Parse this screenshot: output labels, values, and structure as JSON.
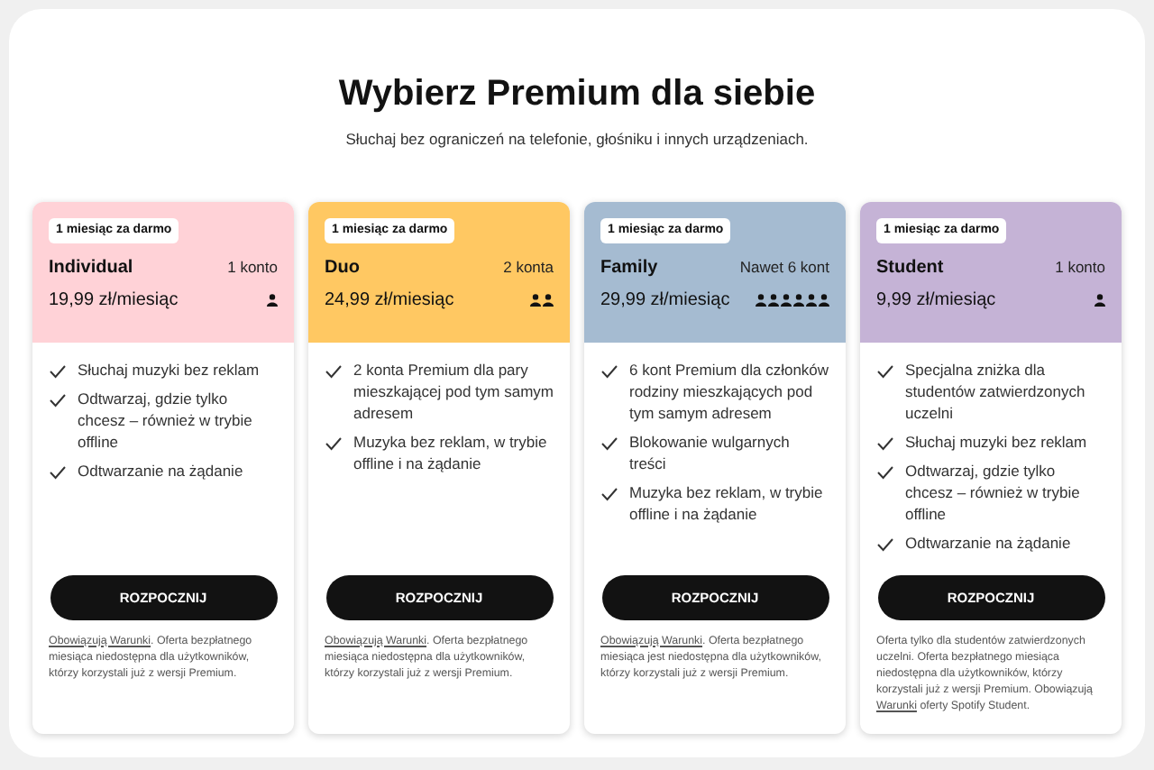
{
  "title": "Wybierz Premium dla siebie",
  "subtitle": "Słuchaj bez ograniczeń na telefonie, głośniku i innych urządzeniach.",
  "plans": [
    {
      "badge": "1 miesiąc za darmo",
      "name": "Individual",
      "accounts": "1 konto",
      "kind": "single",
      "price": "19,99 zł/miesiąc",
      "color": "#ffd2d7",
      "features": [
        "Słuchaj muzyki bez reklam",
        "Odtwarzaj, gdzie tylko chcesz – również w trybie offline",
        "Odtwarzanie na żądanie"
      ],
      "button": "ROZPOCZNIJ",
      "fine_print": [
        {
          "text": "Obowiązują Warunki",
          "link": true
        },
        {
          "text": ". Oferta bezpłatnego miesiąca niedostępna dla użytkowników, którzy korzystali już z wersji Premium.",
          "link": false
        }
      ]
    },
    {
      "badge": "1 miesiąc za darmo",
      "name": "Duo",
      "accounts": "2 konta",
      "kind": "pair",
      "price": "24,99 zł/miesiąc",
      "color": "#ffc862",
      "features": [
        "2 konta Premium dla pary mieszkającej pod tym samym adresem",
        "Muzyka bez reklam, w trybie offline i na żądanie"
      ],
      "button": "ROZPOCZNIJ",
      "fine_print": [
        {
          "text": "Obowiązują Warunki",
          "link": true
        },
        {
          "text": ". Oferta bezpłatnego miesiąca niedostępna dla użytkowników, którzy korzystali już z wersji Premium.",
          "link": false
        }
      ]
    },
    {
      "badge": "1 miesiąc za darmo",
      "name": "Family",
      "accounts": "Nawet 6 kont",
      "kind": "six",
      "price": "29,99 zł/miesiąc",
      "color": "#a5bbd1",
      "features": [
        "6 kont Premium dla członków rodziny mieszkających pod tym samym adresem",
        "Blokowanie wulgarnych treści",
        "Muzyka bez reklam, w trybie offline i na żądanie"
      ],
      "button": "ROZPOCZNIJ",
      "fine_print": [
        {
          "text": "Obowiązują Warunki",
          "link": true
        },
        {
          "text": ". Oferta bezpłatnego miesiąca jest niedostępna dla użytkowników, którzy korzystali już z wersji Premium.",
          "link": false
        }
      ]
    },
    {
      "badge": "1 miesiąc za darmo",
      "name": "Student",
      "accounts": "1 konto",
      "kind": "single",
      "price": "9,99 zł/miesiąc",
      "color": "#c5b3d6",
      "features": [
        "Specjalna zniżka dla studentów zatwierdzonych uczelni",
        "Słuchaj muzyki bez reklam",
        "Odtwarzaj, gdzie tylko chcesz – również w trybie offline",
        "Odtwarzanie na żądanie"
      ],
      "button": "ROZPOCZNIJ",
      "fine_print": [
        {
          "text": "Oferta tylko dla studentów zatwierdzonych uczelni. Oferta bezpłatnego miesiąca niedostępna dla użytkowników, którzy korzystali już z wersji Premium. Obowiązują ",
          "link": false
        },
        {
          "text": "Warunki",
          "link": true
        },
        {
          "text": " oferty Spotify Student.",
          "link": false
        }
      ]
    }
  ]
}
